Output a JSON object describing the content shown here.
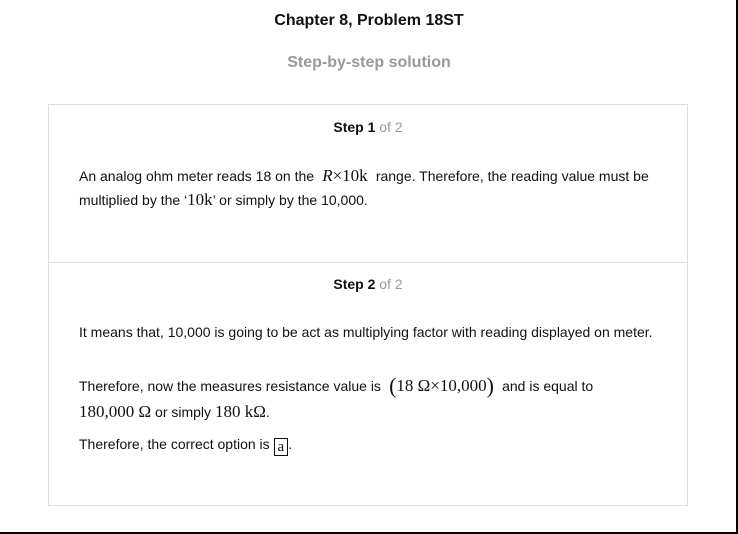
{
  "header": {
    "title": "Chapter 8, Problem 18ST",
    "subtitle": "Step-by-step solution"
  },
  "steps": [
    {
      "label": "Step 1",
      "of": "of 2",
      "text": {
        "a": "An analog ohm meter reads 18 on the",
        "m1_var": "R",
        "m1_rest": "×10k",
        "b": "range. Therefore, the reading value must be multiplied by the ‘",
        "m2": "10k",
        "c": "’ or simply by the 10,000."
      }
    },
    {
      "label": "Step 2",
      "of": "of 2",
      "p1": "It means that, 10,000 is going to be act as multiplying factor with reading displayed on meter.",
      "p2": {
        "a": "Therefore, now the measures resistance value is",
        "m1_open": "(",
        "m1": "18 Ω×10,000",
        "m1_close": ")",
        "b": "and is equal to",
        "m2": "180,000 Ω",
        "c": "or simply",
        "m3": "180 kΩ",
        "d": "."
      },
      "p3": {
        "a": "Therefore, the correct option is",
        "answer": "a",
        "b": "."
      }
    }
  ]
}
